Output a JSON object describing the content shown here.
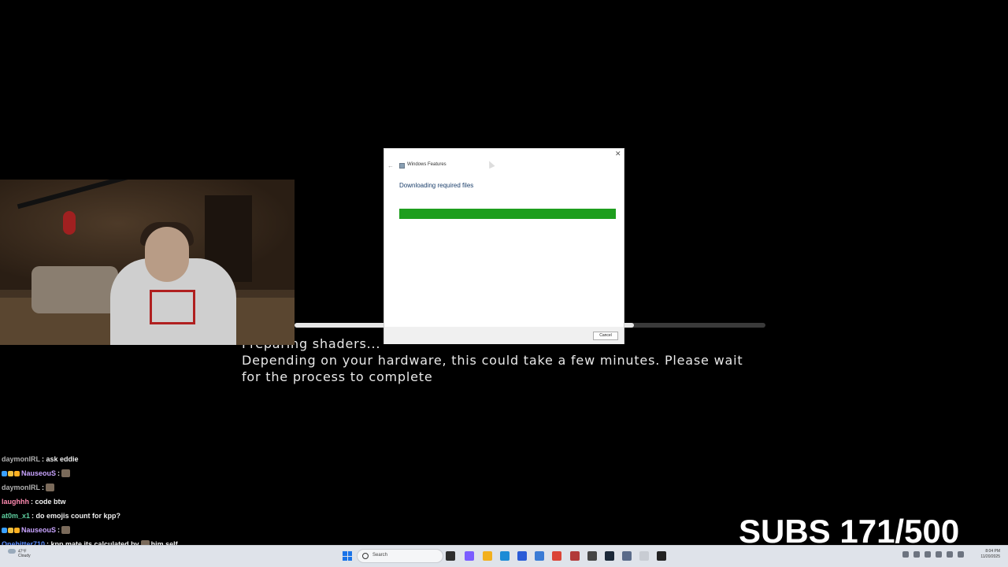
{
  "game": {
    "line1": "Preparing shaders...",
    "line2": "Depending on your hardware, this could take a few minutes. Please wait",
    "line3": "for the process to complete",
    "progress": 0.72
  },
  "dialog": {
    "title": "Windows Features",
    "heading": "Downloading required files",
    "progress": 1.0,
    "cancel_label": "Cancel",
    "back_icon": "←",
    "close_icon": "✕",
    "bar_color": "#1e9e1e"
  },
  "chat": [
    {
      "user": "daymonIRL",
      "color": "#b0b0b0",
      "badges": [],
      "message": ": ask eddie",
      "emote": false
    },
    {
      "user": "NauseouS",
      "color": "#c9a4ff",
      "badges": [
        "#3aa0ff",
        "#f0c040",
        "#ffb020"
      ],
      "message": ":",
      "emote": true
    },
    {
      "user": "daymonIRL",
      "color": "#b0b0b0",
      "badges": [],
      "message": ":",
      "emote": true
    },
    {
      "user": "laughhh",
      "color": "#ff8ab0",
      "badges": [],
      "message": ": code btw",
      "emote": false
    },
    {
      "user": "at0m_x1",
      "color": "#5fd0a0",
      "badges": [],
      "message": ": do emojis count for kpp?",
      "emote": false
    },
    {
      "user": "NauseouS",
      "color": "#c9a4ff",
      "badges": [
        "#3aa0ff",
        "#f0c040",
        "#ffb020"
      ],
      "message": ":",
      "emote": true
    },
    {
      "user": "Onehitter710",
      "color": "#5a8cff",
      "badges": [],
      "message": ": kpp mate its calculated by",
      "emote": true,
      "suffix": "him self"
    }
  ],
  "subs": {
    "label": "SUBS 171/500"
  },
  "taskbar": {
    "weather_temp": "47°F",
    "weather_desc": "Cloudy",
    "search_placeholder": "Search",
    "time": "8:04 PM",
    "date": "11/20/2025",
    "apps": [
      {
        "name": "taskview-icon",
        "color": "#2d2d2d"
      },
      {
        "name": "copilot-icon",
        "color": "#7a5cff"
      },
      {
        "name": "file-explorer-icon",
        "color": "#f2b01e"
      },
      {
        "name": "edge-icon",
        "color": "#1b8bd6"
      },
      {
        "name": "store-icon",
        "color": "#2a5bd7"
      },
      {
        "name": "photos-icon",
        "color": "#3a7bd5"
      },
      {
        "name": "chrome-icon",
        "color": "#db4437"
      },
      {
        "name": "app-icon",
        "color": "#b23a3a"
      },
      {
        "name": "app-icon-2",
        "color": "#444"
      },
      {
        "name": "steam-icon",
        "color": "#1b2838"
      },
      {
        "name": "app-icon-3",
        "color": "#5a6b8a"
      },
      {
        "name": "app-icon-4",
        "color": "#c8ccd3"
      },
      {
        "name": "obs-icon",
        "color": "#222"
      }
    ]
  }
}
